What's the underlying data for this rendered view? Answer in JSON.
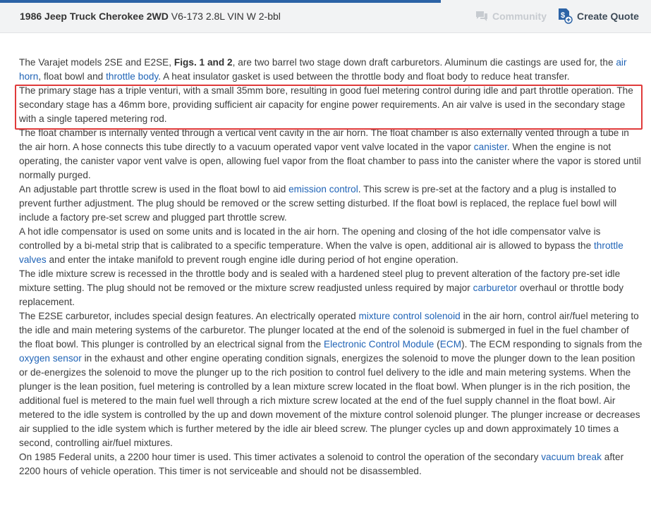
{
  "header": {
    "vehicle_bold": "1986 Jeep Truck Cherokee 2WD",
    "vehicle_rest": " V6-173 2.8L VIN W 2-bbl",
    "community_label": "Community",
    "create_quote_label": "Create Quote"
  },
  "article": {
    "p1": {
      "t1": "The Varajet models 2SE and E2SE, ",
      "figs": "Figs. 1 and 2",
      "t2": ", are two barrel two stage down draft carburetors. Aluminum die castings are used for, the ",
      "link_airhorn": "air horn",
      "t3": ", float bowl and ",
      "link_throttle_body": "throttle body",
      "t4": ". A heat insulator gasket is used between the throttle body and float body to reduce heat transfer."
    },
    "p2": "The primary stage has a triple venturi, with a small 35mm bore, resulting in good fuel metering control during idle and part throttle operation. The secondary stage has a 46mm bore, providing sufficient air capacity for engine power requirements. An air valve is used in the secondary stage with a single tapered metering rod.",
    "p3": {
      "t1": "The float chamber is internally vented through a vertical vent cavity in the air horn. The float chamber is also externally vented through a tube in the air horn. A hose connects this tube directly to a vacuum operated vapor vent valve located in the vapor ",
      "link_canister": "canister",
      "t2": ". When the engine is not operating, the canister vapor vent valve is open, allowing fuel vapor from the float chamber to pass into the canister where the vapor is stored until normally purged."
    },
    "p4": {
      "t1": "An adjustable part throttle screw is used in the float bowl to aid ",
      "link_emission": "emission control",
      "t2": ". This screw is pre-set at the factory and a plug is installed to prevent further adjustment. The plug should be removed or the screw setting disturbed. If the float bowl is replaced, the replace fuel bowl will include a factory pre-set screw and plugged part throttle screw."
    },
    "p5": {
      "t1": "A hot idle compensator is used on some units and is located in the air horn. The opening and closing of the hot idle compensator valve is controlled by a bi-metal strip that is calibrated to a specific temperature. When the valve is open, additional air is allowed to bypass the ",
      "link_throttle_valves": "throttle valves",
      "t2": " and enter the intake manifold to prevent rough engine idle during period of hot engine operation."
    },
    "p6": {
      "t1": "The idle mixture screw is recessed in the throttle body and is sealed with a hardened steel plug to prevent alteration of the factory pre-set idle mixture setting. The plug should not be removed or the mixture screw readjusted unless required by major ",
      "link_carburetor": "carburetor",
      "t2": " overhaul or throttle body replacement."
    },
    "p7": {
      "t1": "The E2SE carburetor, includes special design features. An electrically operated ",
      "link_mcs": "mixture control solenoid",
      "t2": " in the air horn, control air/fuel metering to the idle and main metering systems of the carburetor. The plunger located at the end of the solenoid is submerged in fuel in the fuel chamber of the float bowl. This plunger is controlled by an electrical signal from the ",
      "link_ecm_full": "Electronic Control Module",
      "t3": " (",
      "link_ecm": "ECM",
      "t4": "). The ECM responding to signals from the ",
      "link_o2": "oxygen sensor",
      "t5": " in the exhaust and other engine operating condition signals, energizes the solenoid to move the plunger down to the lean position or de-energizes the solenoid to move the plunger up to the rich position to control fuel delivery to the idle and main metering systems. When the plunger is the lean position, fuel metering is controlled by a lean mixture screw located in the float bowl. When plunger is in the rich position, the additional fuel is metered to the main fuel well through a rich mixture screw located at the end of the fuel supply channel in the float bowl. Air metered to the idle system is controlled by the up and down movement of the mixture control solenoid plunger. The plunger increase or decreases air supplied to the idle system which is further metered by the idle air bleed screw. The plunger cycles up and down approximately 10 times a second, controlling air/fuel mixtures."
    },
    "p8": {
      "t1": "On 1985 Federal units, a 2200 hour timer is used. This timer activates a solenoid to control the operation of the secondary ",
      "link_vacuum": "vacuum break",
      "t2": " after 2200 hours of vehicle operation. This timer is not serviceable and should not be disassembled."
    }
  },
  "colors": {
    "link": "#1f63b6",
    "highlight_border": "#e03a3a",
    "accent_bar": "#2c63a6"
  }
}
